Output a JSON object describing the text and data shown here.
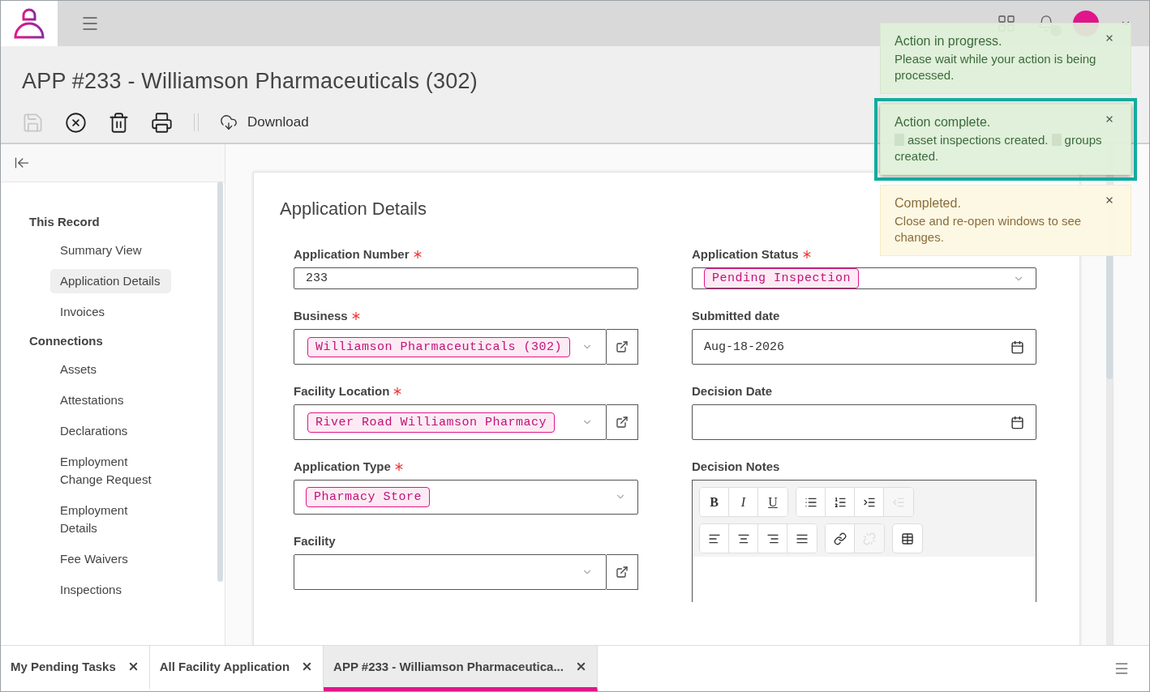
{
  "page": {
    "title": "APP #233 - Williamson Pharmaceuticals (302)"
  },
  "toolbar": {
    "buttons": [
      {
        "kind": "save",
        "disabled": true
      },
      {
        "kind": "cancel",
        "disabled": false
      },
      {
        "kind": "delete",
        "disabled": false
      },
      {
        "kind": "print",
        "disabled": false
      }
    ],
    "download": "Download"
  },
  "sidebar": {
    "sections": [
      {
        "title": "This Record",
        "items": [
          {
            "label": "Summary View",
            "selected": false
          },
          {
            "label": "Application Details",
            "selected": true
          },
          {
            "label": "Invoices",
            "selected": false
          }
        ]
      },
      {
        "title": "Connections",
        "items": [
          {
            "label": "Assets",
            "selected": false
          },
          {
            "label": "Attestations",
            "selected": false
          },
          {
            "label": "Declarations",
            "selected": false
          },
          {
            "label": "Employment Change Request",
            "selected": false
          },
          {
            "label": "Employment Details",
            "selected": false
          },
          {
            "label": "Fee Waivers",
            "selected": false
          },
          {
            "label": "Inspections",
            "selected": false
          }
        ]
      }
    ]
  },
  "form": {
    "title": "Application Details",
    "fields": [
      {
        "label": "Application Number",
        "required": true,
        "kind": "text",
        "value": "233"
      },
      {
        "label": "Application Status",
        "required": true,
        "kind": "select",
        "tag": "Pending Inspection"
      },
      {
        "label": "Business",
        "required": true,
        "kind": "lookup",
        "tag": "Williamson Pharmaceuticals (302)"
      },
      {
        "label": "Submitted date",
        "required": false,
        "kind": "date",
        "value": "Aug-18-2026"
      },
      {
        "label": "Facility Location",
        "required": true,
        "kind": "lookup",
        "tag": "River Road Williamson Pharmacy"
      },
      {
        "label": "Decision Date",
        "required": false,
        "kind": "date"
      },
      {
        "label": "Application Type",
        "required": true,
        "kind": "select",
        "tag": "Pharmacy Store"
      },
      {
        "label": "Decision Notes",
        "required": false,
        "kind": "richtext",
        "toolbar_rows": [
          [
            [
              {
                "kind": "bold",
                "label": "B",
                "disabled": false
              },
              {
                "kind": "italic",
                "label": "I",
                "disabled": false
              },
              {
                "kind": "underline",
                "label": "U",
                "disabled": false
              }
            ],
            [
              {
                "kind": "bullets",
                "disabled": false
              },
              {
                "kind": "numbers",
                "disabled": false
              },
              {
                "kind": "indent",
                "disabled": false
              },
              {
                "kind": "outdent",
                "disabled": true
              }
            ]
          ],
          [
            [
              {
                "kind": "align-left",
                "disabled": false
              },
              {
                "kind": "align-center",
                "disabled": false
              },
              {
                "kind": "align-right",
                "disabled": false
              },
              {
                "kind": "justify",
                "disabled": false
              }
            ],
            [
              {
                "kind": "link",
                "disabled": false
              },
              {
                "kind": "unlink",
                "disabled": true
              }
            ],
            [
              {
                "kind": "table",
                "disabled": false
              }
            ]
          ]
        ]
      },
      {
        "label": "Facility",
        "required": false,
        "kind": "lookup"
      }
    ]
  },
  "toasts": [
    {
      "kind": "success",
      "title": "Action in progress.",
      "highlighted": false,
      "message": [
        {
          "kind": "text",
          "text": "Please wait while your action is being processed."
        }
      ]
    },
    {
      "kind": "success",
      "title": "Action complete.",
      "highlighted": true,
      "message": [
        {
          "kind": "redacted"
        },
        {
          "kind": "text",
          "text": "asset inspections created."
        },
        {
          "kind": "redacted"
        },
        {
          "kind": "text",
          "text": "groups created."
        }
      ]
    },
    {
      "kind": "warning",
      "title": "Completed.",
      "highlighted": false,
      "message": [
        {
          "kind": "text",
          "text": "Close and re-open windows to see changes."
        }
      ]
    }
  ],
  "bottom_tabs": [
    {
      "label": "My Pending Tasks",
      "selected": false
    },
    {
      "label": "All Facility Application",
      "selected": false
    },
    {
      "label": "APP #233 - Williamson Pharmaceutica...",
      "selected": true
    }
  ]
}
